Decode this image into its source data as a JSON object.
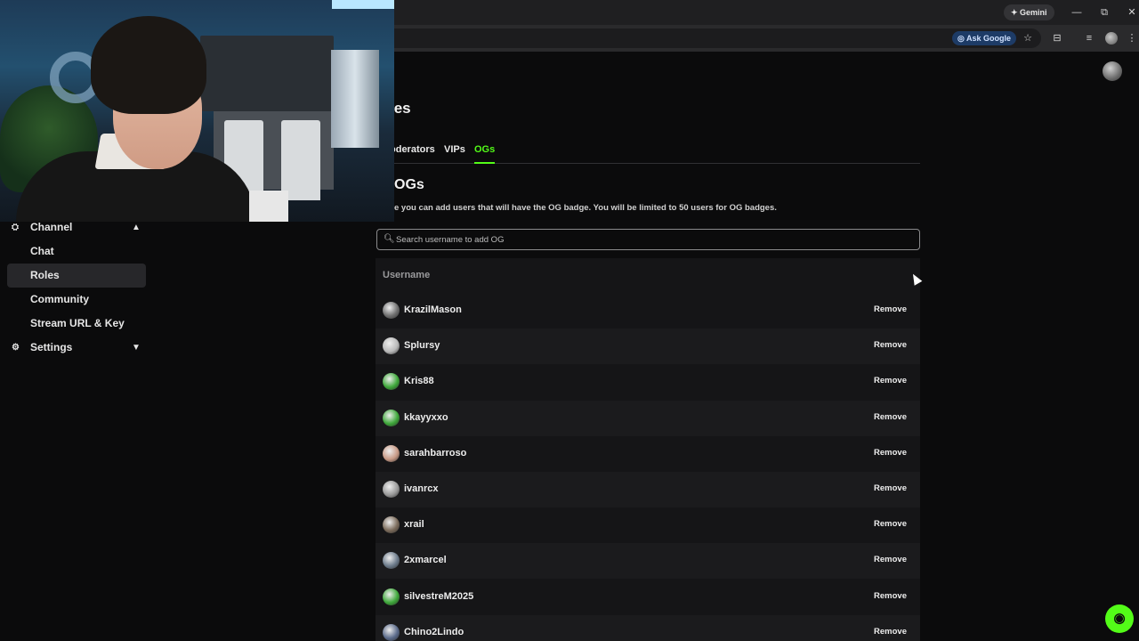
{
  "browser": {
    "gemini_label": "Gemini",
    "ask_google_label": "Ask Google",
    "window_controls": {
      "minimize": "—",
      "restore": "⧉",
      "close": "✕"
    }
  },
  "sidebar": {
    "items": [
      {
        "label": "Channel",
        "icon": "channel-icon",
        "type": "parent",
        "expanded": true
      },
      {
        "label": "Chat",
        "type": "child"
      },
      {
        "label": "Roles",
        "type": "child",
        "active": true
      },
      {
        "label": "Community",
        "type": "child"
      },
      {
        "label": "Stream URL & Key",
        "type": "child"
      },
      {
        "label": "Settings",
        "icon": "gear-icon",
        "type": "parent",
        "expanded": false
      }
    ]
  },
  "main": {
    "heading": "les",
    "tabs": [
      {
        "label": "oderators",
        "active": false
      },
      {
        "label": "VIPs",
        "active": false
      },
      {
        "label": "OGs",
        "active": true
      }
    ],
    "section_title": "OGs",
    "section_desc": "e you can add users that will have the OG badge. You will be limited to 50 users for OG badges.",
    "search_placeholder": "Search username to add OG",
    "table_header": "Username",
    "remove_label": "Remove",
    "rows": [
      {
        "username": "KrazilMason",
        "avatar_color": "#6f6f6f"
      },
      {
        "username": "Splursy",
        "avatar_color": "#b9b9b9"
      },
      {
        "username": "Kris88",
        "avatar_color": "#3ea83a"
      },
      {
        "username": "kkayyxxo",
        "avatar_color": "#3ea83a"
      },
      {
        "username": "sarahbarroso",
        "avatar_color": "#c89a86"
      },
      {
        "username": "ivanrcx",
        "avatar_color": "#9a9a9a"
      },
      {
        "username": "xrail",
        "avatar_color": "#7a6a5a"
      },
      {
        "username": "2xmarcel",
        "avatar_color": "#6b7a8a"
      },
      {
        "username": "silvestreM2025",
        "avatar_color": "#3ea83a"
      },
      {
        "username": "Chino2Lindo",
        "avatar_color": "#5a6a8a"
      }
    ]
  },
  "accent_color": "#53fc18"
}
